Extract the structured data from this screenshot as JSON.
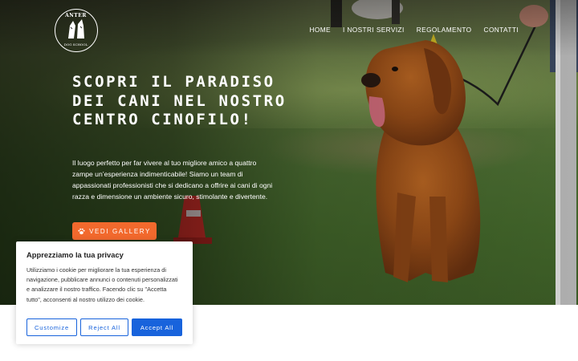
{
  "brand": {
    "logo_top_text": "ANTER",
    "logo_bottom_text": "DOG SCHOOL",
    "colors": {
      "accent": "#f2692d",
      "cookie_primary": "#1863dc"
    }
  },
  "nav": {
    "items": [
      {
        "label": "HOME"
      },
      {
        "label": "I NOSTRI SERVIZI"
      },
      {
        "label": "REGOLAMENTO"
      },
      {
        "label": "CONTATTI"
      }
    ]
  },
  "hero": {
    "title": "Scopri il paradiso dei cani nel nostro centro cinofilo!",
    "text": "Il luogo perfetto per far vivere al tuo migliore amico a quattro zampe un’esperienza indimenticabile! Siamo un team di appassionati professionisti che si dedicano a offrire ai cani di ogni razza e dimensione un ambiente sicuro, stimolante e divertente.",
    "button_label": "VEDI GALLERY",
    "button_icon": "paw-icon"
  },
  "cookie": {
    "title": "Apprezziamo la tua privacy",
    "text": "Utilizziamo i cookie per migliorare la tua esperienza di navigazione, pubblicare annunci o contenuti personalizzati e analizzare il nostro traffico. Facendo clic su \"Accetta tutto\", acconsenti al nostro utilizzo dei cookie.",
    "customize_label": "Customize",
    "reject_label": "Reject All",
    "accept_label": "Accept All"
  }
}
